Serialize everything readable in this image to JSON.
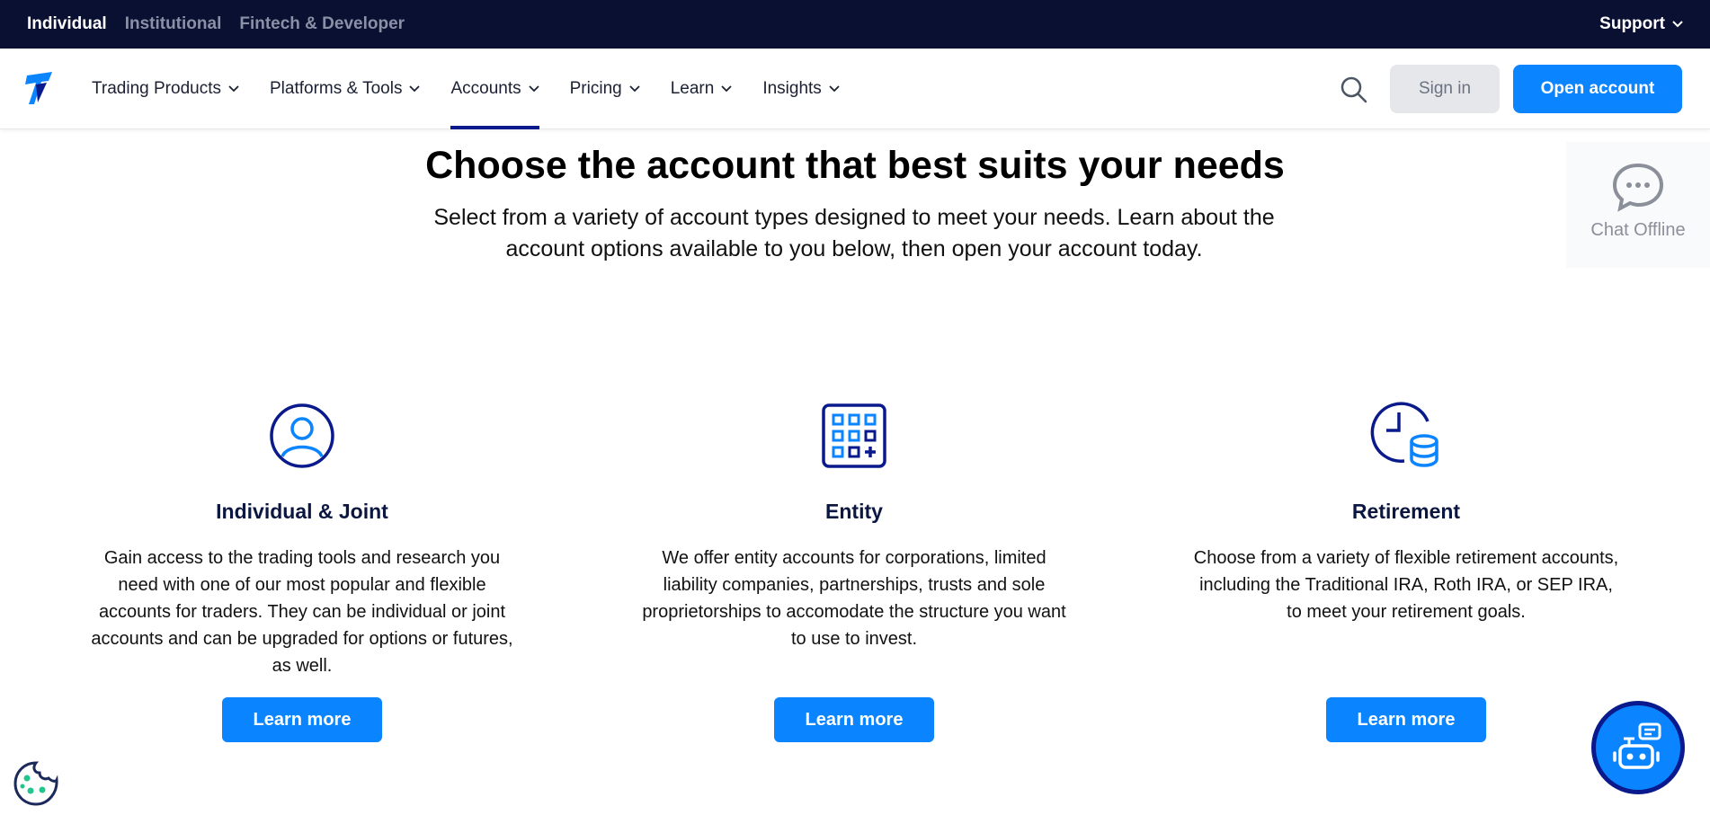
{
  "topbar": {
    "segments": [
      "Individual",
      "Institutional",
      "Fintech & Developer"
    ],
    "support": "Support"
  },
  "nav": {
    "items": [
      "Trading Products",
      "Platforms & Tools",
      "Accounts",
      "Pricing",
      "Learn",
      "Insights"
    ],
    "active": "Accounts",
    "sign_in": "Sign in",
    "open_account": "Open account"
  },
  "hero": {
    "title": "Choose the account that best suits your needs",
    "subtitle": "Select from a variety of account types designed to meet your needs. Learn about the account options available to you below, then open your account today."
  },
  "chat": {
    "label": "Chat Offline"
  },
  "cards": [
    {
      "title": "Individual & Joint",
      "body": "Gain access to the trading tools and research you need with one of our most popular and flexible accounts for traders. They can be individual or joint accounts and can be upgraded for options or futures, as well.",
      "cta": "Learn more",
      "icon": "user-circle-icon"
    },
    {
      "title": "Entity",
      "body": "We offer entity accounts for corporations, limited liability companies, partnerships, trusts and sole proprietorships to accomodate the structure you want to use to invest.",
      "cta": "Learn more",
      "icon": "building-grid-icon"
    },
    {
      "title": "Retirement",
      "body": "Choose from a variety of flexible retirement accounts, including the Traditional IRA, Roth IRA, or SEP IRA, to meet your retirement goals.",
      "cta": "Learn more",
      "icon": "clock-coins-icon"
    }
  ],
  "colors": {
    "topbar": "#0a1031",
    "accent": "#0a84ff",
    "navy": "#0a1a8c"
  }
}
